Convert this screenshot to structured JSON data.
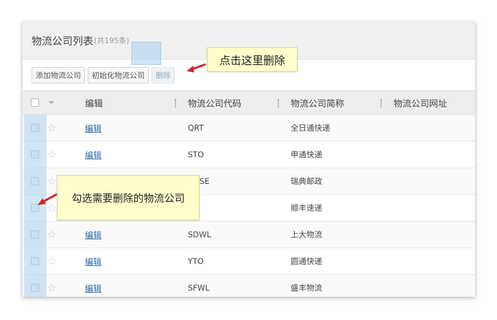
{
  "panel": {
    "title": "物流公司列表",
    "count": "(共195条)"
  },
  "toolbar": {
    "add_label": "添加物流公司",
    "init_label": "初始化物流公司",
    "delete_label": "删除"
  },
  "table": {
    "headers": {
      "edit": "编辑",
      "code": "物流公司代码",
      "name": "物流公司简称",
      "url": "物流公司网址"
    },
    "rows": [
      {
        "edit": "编辑",
        "code": "QRT",
        "name": "全日通快递"
      },
      {
        "edit": "编辑",
        "code": "STO",
        "name": "申通快递"
      },
      {
        "edit": "",
        "code": "SE",
        "name": "瑞典邮政"
      },
      {
        "edit": "",
        "code": "",
        "name": "顺丰速递"
      },
      {
        "edit": "编辑",
        "code": "SDWL",
        "name": "上大物流"
      },
      {
        "edit": "编辑",
        "code": "YTO",
        "name": "圆通快递"
      },
      {
        "edit": "编辑",
        "code": "SFWL",
        "name": "盛丰物流"
      }
    ]
  },
  "annotations": {
    "delete_tip": "点击这里删除",
    "select_tip": "勾选需要删除的物流公司",
    "arrow_color": "#d9202b",
    "highlight_color": "#aad2f0"
  }
}
